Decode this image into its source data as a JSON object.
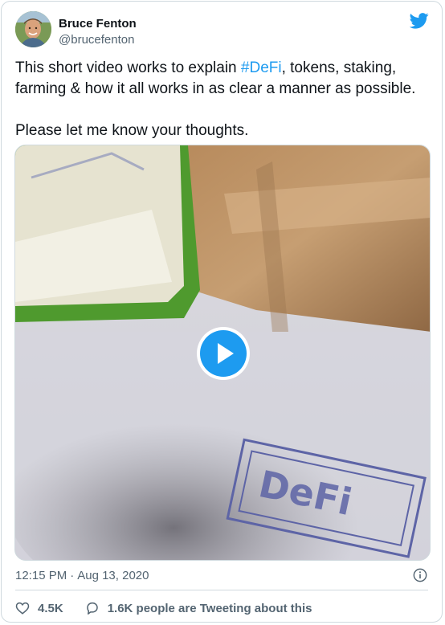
{
  "author": {
    "name": "Bruce Fenton",
    "handle": "@brucefenton",
    "avatar_icon": "avatar-photo"
  },
  "tweet": {
    "text_before_hashtag": "This short video works to explain ",
    "hashtag": "#DeFi",
    "text_after_hashtag": ", tokens, staking, farming & how it all works in as clear a manner as possible.",
    "second_paragraph": "Please let me know your thoughts."
  },
  "media": {
    "type": "video",
    "play_icon": "play-icon",
    "handwritten_label": "DeFi"
  },
  "meta": {
    "time": "12:15 PM",
    "separator": "·",
    "date": "Aug 13, 2020"
  },
  "footer": {
    "likes": "4.5K",
    "conversation": "1.6K people are Tweeting about this"
  },
  "colors": {
    "accent": "#1d9bf0",
    "text": "#0f1419",
    "secondary_text": "#536471",
    "border": "#cfd9de"
  }
}
